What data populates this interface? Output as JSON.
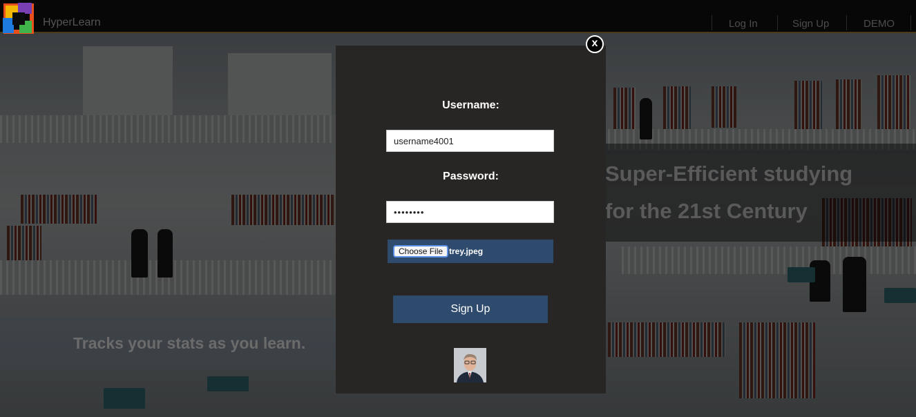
{
  "app": {
    "brand": "HyperLearn"
  },
  "nav": {
    "login": "Log In",
    "signup": "Sign Up",
    "demo": "DEMO"
  },
  "hero": {
    "line1": "Super-Efficient studying",
    "line2": "for the 21st Century",
    "stats": "Tracks your stats as you learn."
  },
  "modal": {
    "close_label": "x",
    "username_label": "Username:",
    "username_value": "username4001",
    "password_label": "Password:",
    "password_value": "••••••••",
    "choose_file_label": "Choose File",
    "file_name": "trey.jpeg",
    "submit_label": "Sign Up"
  },
  "colors": {
    "accent": "#2e4a6d",
    "modal_bg": "#282624",
    "topbar": "#070707"
  },
  "icons": {
    "close": "close-icon",
    "logo": "hyperlearn-logo",
    "avatar": "user-avatar"
  }
}
